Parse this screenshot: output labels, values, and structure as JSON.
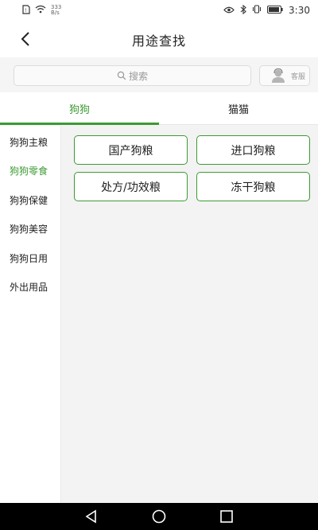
{
  "status_bar": {
    "net_speed_value": "333",
    "net_speed_unit": "B/s",
    "time": "3:30"
  },
  "header": {
    "title": "用途查找"
  },
  "search": {
    "placeholder": "搜索",
    "service_label": "客服"
  },
  "tabs": [
    {
      "label": "狗狗",
      "active": true
    },
    {
      "label": "猫猫",
      "active": false
    }
  ],
  "sidebar": {
    "items": [
      {
        "label": "狗狗主粮"
      },
      {
        "label": "狗狗零食",
        "active": true
      },
      {
        "label": "狗狗保健"
      },
      {
        "label": "狗狗美容"
      },
      {
        "label": "狗狗日用"
      },
      {
        "label": "外出用品"
      }
    ]
  },
  "categories": [
    {
      "label": "国产狗粮"
    },
    {
      "label": "进口狗粮"
    },
    {
      "label": "处方/功效粮"
    },
    {
      "label": "冻干狗粮"
    }
  ],
  "colors": {
    "accent": "#3d9a34",
    "nav_bar": "#000000"
  }
}
